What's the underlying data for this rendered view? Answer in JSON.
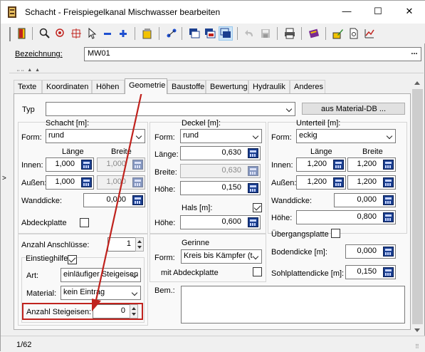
{
  "window": {
    "title": "Schacht - Freispiegelkanal Mischwasser bearbeiten",
    "minimize": "—",
    "maximize": "☐",
    "close": "✕"
  },
  "bezeichnung": {
    "label": "Bezeichnung:",
    "value": "MW01",
    "more": "..."
  },
  "tabs": [
    "Texte",
    "Koordinaten",
    "Höhen",
    "Geometrie",
    "Baustoffe",
    "Bewertung",
    "Hydraulik",
    "Anderes"
  ],
  "typ": {
    "label": "Typ",
    "value": "",
    "material_button": "aus Material-DB ..."
  },
  "schacht": {
    "title": "Schacht [m]:",
    "form_label": "Form:",
    "form": "rund",
    "laenge_label": "Länge",
    "breite_label": "Breite",
    "innen_label": "Innen:",
    "innen_laenge": "1,000",
    "innen_breite": "1,000",
    "aussen_label": "Außen:",
    "aussen_laenge": "1,000",
    "aussen_breite": "1,000",
    "wanddicke_label": "Wanddicke:",
    "wanddicke": "0,000",
    "abdeckplatte_label": "Abdeckplatte"
  },
  "deckel": {
    "title": "Deckel [m]:",
    "form_label": "Form:",
    "form": "rund",
    "laenge_label": "Länge:",
    "laenge": "0,630",
    "breite_label": "Breite:",
    "breite": "0,630",
    "hoehe_label": "Höhe:",
    "hoehe": "0,150"
  },
  "hals": {
    "title": "Hals [m]:",
    "hoehe_label": "Höhe:",
    "hoehe": "0,600"
  },
  "unterteil": {
    "title": "Unterteil [m]:",
    "form_label": "Form:",
    "form": "eckig",
    "laenge_label": "Länge",
    "breite_label": "Breite",
    "innen_label": "Innen:",
    "innen_laenge": "1,200",
    "innen_breite": "1,200",
    "aussen_label": "Außen:",
    "aussen_laenge": "1,200",
    "aussen_breite": "1,200",
    "wanddicke_label": "Wanddicke:",
    "wanddicke": "0,000",
    "hoehe_label": "Höhe:",
    "hoehe": "0,800",
    "uebergangsplatte_label": "Übergangsplatte"
  },
  "anschluesse": {
    "label": "Anzahl Anschlüsse:",
    "value": "1"
  },
  "einstieg": {
    "title": "Einstieghilfe",
    "art_label": "Art:",
    "art": "einläufiger Steigeisen",
    "material_label": "Material:",
    "material": "kein Eintrag",
    "anzahl_label": "Anzahl Steigeisen:",
    "anzahl": "0"
  },
  "gerinne": {
    "title": "Gerinne",
    "form_label": "Form:",
    "form": "Kreis bis Kämpfer (t",
    "abdeckplatte_label": "mit Abdeckplatte"
  },
  "bem": {
    "label": "Bem.:",
    "value": ""
  },
  "unterteil_extra": {
    "bodendicke_label": "Bodendicke [m]:",
    "bodendicke": "0,000",
    "sohlplatte_label": "Sohlplattendicke [m]:",
    "sohlplatte": "0,150"
  },
  "status": {
    "record": "1/62"
  },
  "colors": {
    "annotation": "#c0231e"
  }
}
